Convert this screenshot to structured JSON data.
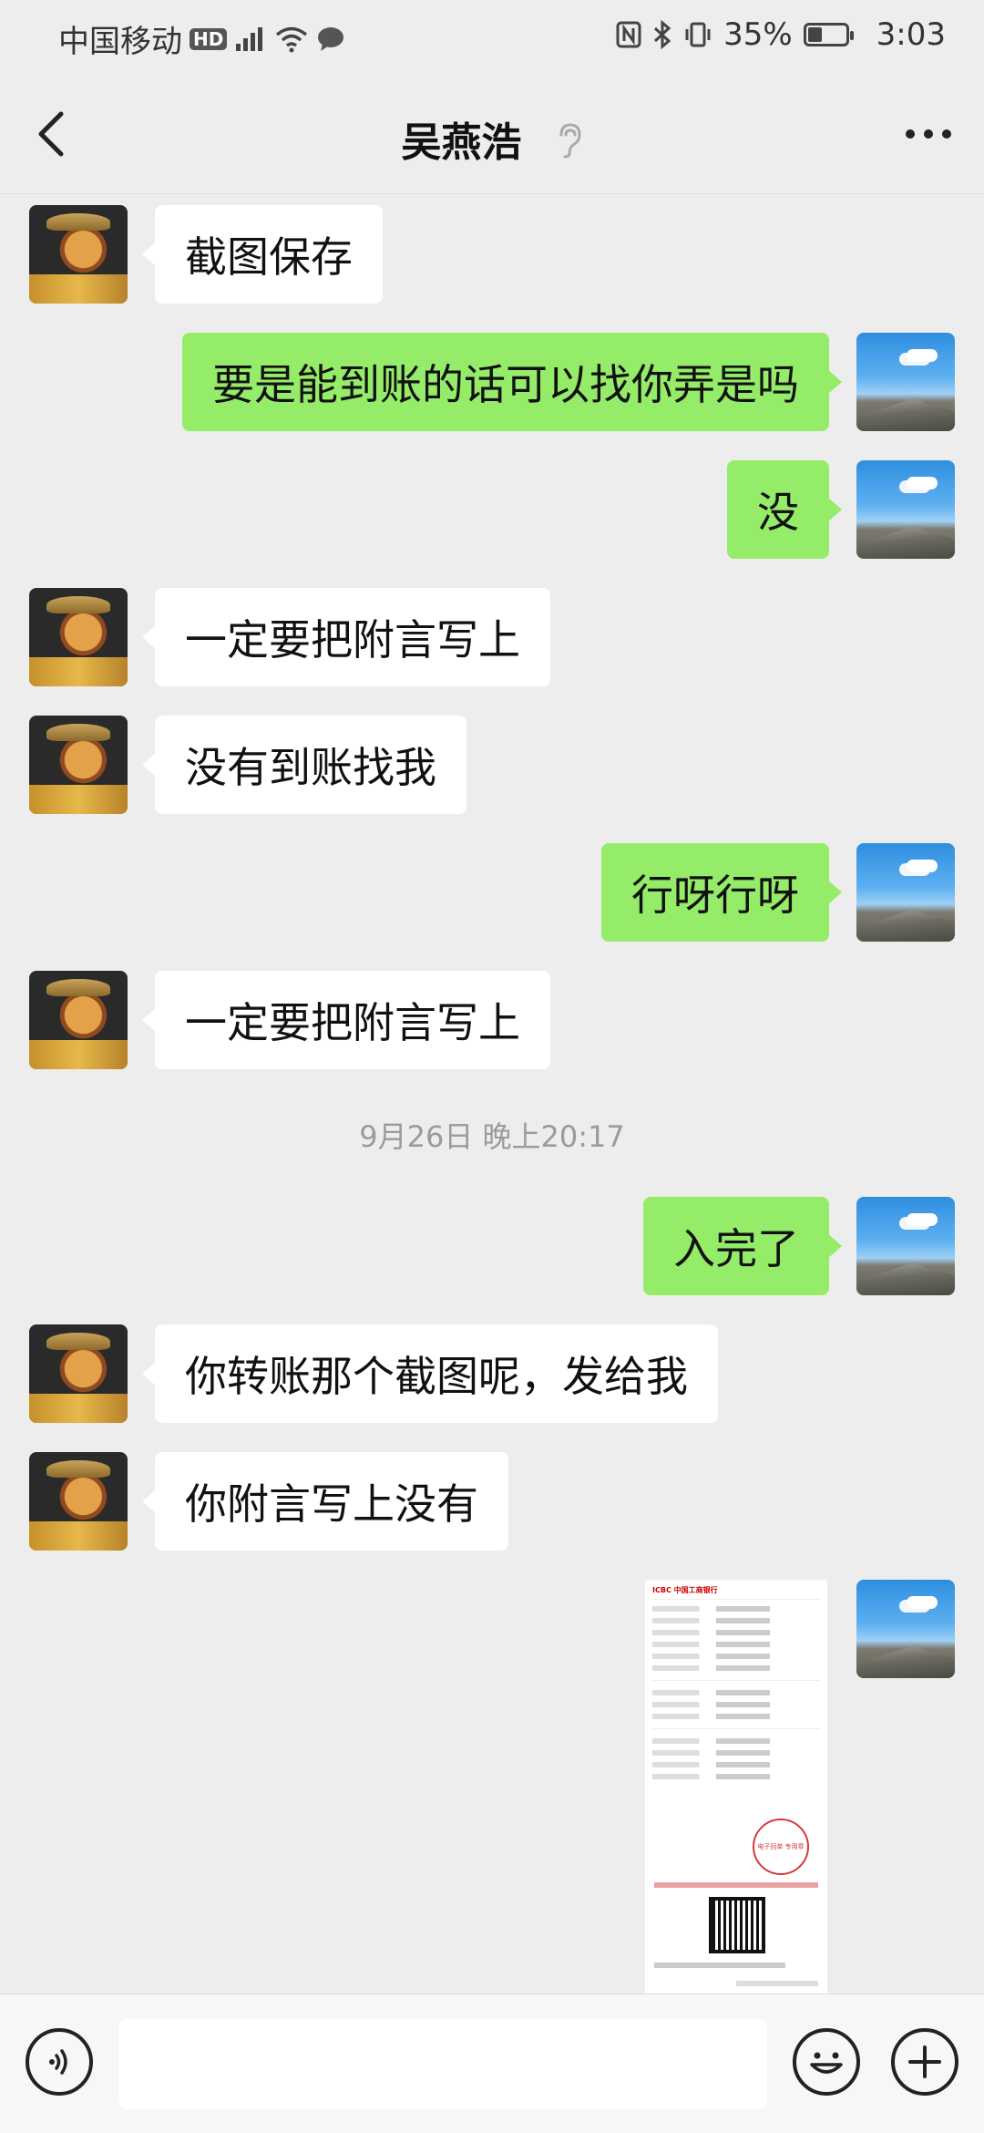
{
  "status_bar": {
    "carrier": "中国移动",
    "hd": "HD",
    "network": "4G",
    "battery_percent": "35%",
    "battery_level": 0.35,
    "time": "3:03"
  },
  "header": {
    "title": "吴燕浩"
  },
  "colors": {
    "background": "#ededed",
    "incoming_bubble": "#ffffff",
    "outgoing_bubble": "#95ec69",
    "timestamp_text": "#9b9b9b"
  },
  "messages": [
    {
      "side": "in",
      "text": "截图保存"
    },
    {
      "side": "out",
      "text": "要是能到账的话可以找你弄是吗"
    },
    {
      "side": "out",
      "text": "没"
    },
    {
      "side": "in",
      "text": "一定要把附言写上"
    },
    {
      "side": "in",
      "text": "没有到账找我"
    },
    {
      "side": "out",
      "text": "行呀行呀"
    },
    {
      "side": "in",
      "text": "一定要把附言写上"
    },
    {
      "side": "time",
      "text": "9月26日 晚上20:17"
    },
    {
      "side": "out",
      "text": "入完了"
    },
    {
      "side": "in",
      "text": "你转账那个截图呢，发给我"
    },
    {
      "side": "in",
      "text": "你附言写上没有"
    },
    {
      "side": "out",
      "kind": "image"
    }
  ],
  "receipt": {
    "bank": "ICBC 中国工商银行",
    "stamp": "电子回单 专用章"
  },
  "input_bar": {
    "placeholder": ""
  }
}
